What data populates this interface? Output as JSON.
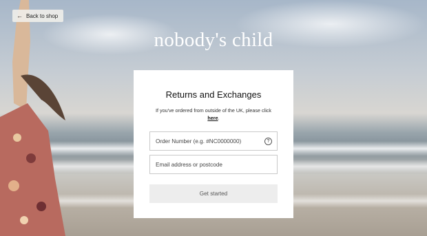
{
  "back": {
    "label": "Back to shop",
    "icon": "arrow-left-icon"
  },
  "brand": {
    "name": "nobody's child"
  },
  "form": {
    "title": "Returns and Exchanges",
    "subtitle_prefix": "If you've ordered from outside of the UK, please click",
    "subtitle_link": "here",
    "subtitle_suffix": ".",
    "order_field": {
      "placeholder": "Order Number (e.g. #NC0000000)",
      "icon": "help-icon"
    },
    "email_field": {
      "placeholder": "Email address or postcode"
    },
    "submit_label": "Get started"
  },
  "colors": {
    "card": "#ffffff",
    "button_bg": "#ededed",
    "field_border": "#c9c9c9",
    "brand_text": "#ffffff"
  }
}
